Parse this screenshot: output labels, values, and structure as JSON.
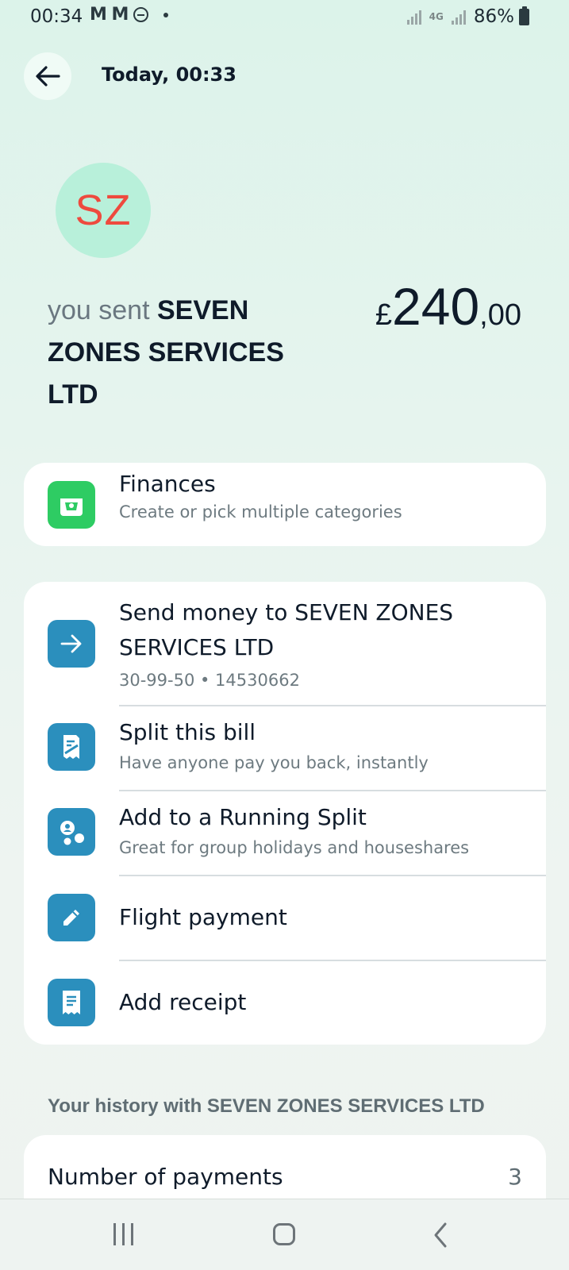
{
  "status_bar": {
    "time": "00:34",
    "mail_icons": "M M",
    "network": "4G",
    "battery": "86%"
  },
  "header": {
    "title": "Today, 00:33"
  },
  "payee": {
    "initials": "SZ",
    "sent_prefix": "you sent ",
    "name": "SEVEN ZONES SERVICES LTD"
  },
  "amount": {
    "currency": "£",
    "major": "240",
    "minor": ",00"
  },
  "category": {
    "title": "Finances",
    "subtitle": "Create or pick multiple categories"
  },
  "actions": [
    {
      "title": "Send money to SEVEN ZONES SERVICES LTD",
      "subtitle": "30-99-50 • 14530662",
      "icon": "arrow-right-icon"
    },
    {
      "title": "Split this bill",
      "subtitle": "Have anyone pay you back, instantly",
      "icon": "split-bill-icon"
    },
    {
      "title": "Add to a Running Split",
      "subtitle": "Great for group holidays and houseshares",
      "icon": "running-split-icon"
    },
    {
      "title": "Flight payment",
      "subtitle": "",
      "icon": "pencil-icon"
    },
    {
      "title": "Add receipt",
      "subtitle": "",
      "icon": "receipt-icon"
    }
  ],
  "history": {
    "label": "Your history with SEVEN ZONES SERVICES LTD",
    "rows": [
      {
        "label": "Number of payments",
        "value": "3"
      }
    ]
  },
  "colors": {
    "accent_blue": "#2b8fbd",
    "accent_green": "#2ecc63",
    "avatar_bg": "#b8f0da",
    "avatar_text": "#ee4a3e"
  }
}
